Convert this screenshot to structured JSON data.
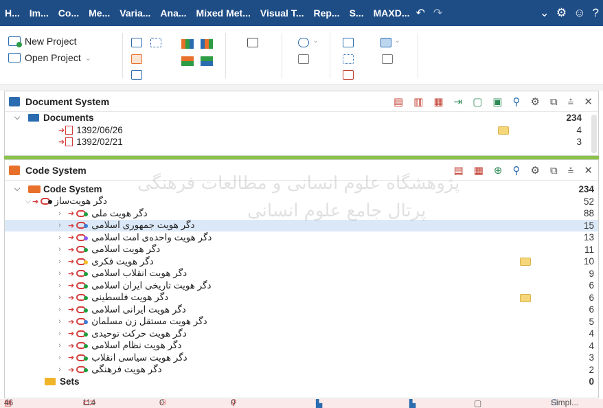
{
  "menubar": {
    "tabs": [
      "H...",
      "Im...",
      "Co...",
      "Me...",
      "Varia...",
      "Ana...",
      "Mixed Met...",
      "Visual T...",
      "Rep...",
      "S...",
      "MAXD..."
    ],
    "undo_icon": "undo-icon",
    "redo_icon": "redo-icon",
    "controls": [
      "chevron-down-icon",
      "gear-icon",
      "smiley-icon",
      "help-icon"
    ],
    "bg_color": "#1e4d86"
  },
  "ribbon": {
    "new_project": "New Project",
    "open_project": "Open Project"
  },
  "document_system": {
    "title": "Document System",
    "root": {
      "label": "Documents",
      "count": "234"
    },
    "items": [
      {
        "label": "1392/06/26",
        "count": "4"
      },
      {
        "label": "1392/02/21",
        "count": "3"
      }
    ]
  },
  "code_system": {
    "title": "Code System",
    "root": {
      "label": "Code System",
      "count": "234"
    },
    "group": {
      "label": "دگر هویت‌ساز",
      "count": "52"
    },
    "items": [
      {
        "label": "دگر هویت ملی",
        "count": "88"
      },
      {
        "label": "دگر هویت جمهوری اسلامی",
        "count": "15"
      },
      {
        "label": "دگر هویت واحده‌ی امت اسلامی",
        "count": "13"
      },
      {
        "label": "دگر هویت اسلامی",
        "count": "11"
      },
      {
        "label": "دگر هویت فکری",
        "count": "10"
      },
      {
        "label": "دگر هویت انقلاب اسلامی",
        "count": "9"
      },
      {
        "label": "دگر هویت تاریخی ایران اسلامی",
        "count": "6"
      },
      {
        "label": "دگر هویت فلسطینی",
        "count": "6"
      },
      {
        "label": "دگر هویت ایرانی اسلامی",
        "count": "6"
      },
      {
        "label": "دگر هویت مستقل زن مسلمان",
        "count": "5"
      },
      {
        "label": "دگر هویت حرکت توحیدی",
        "count": "4"
      },
      {
        "label": "دگر هویت نظام اسلامی",
        "count": "4"
      },
      {
        "label": "دگر هویت سیاسی انقلاب",
        "count": "3"
      },
      {
        "label": "دگر هویت فرهنگی",
        "count": "2"
      }
    ],
    "sets": {
      "label": "Sets",
      "count": "0"
    }
  },
  "statusbar": {
    "documents": "46",
    "codes": "114",
    "memos": "0",
    "links": "0",
    "mode": "Simpl..."
  },
  "watermark": {
    "line1": "پژوهشگاه علوم انسانی و مطالعات فرهنگی",
    "line2": "پرتال جامع علوم انسانی"
  }
}
